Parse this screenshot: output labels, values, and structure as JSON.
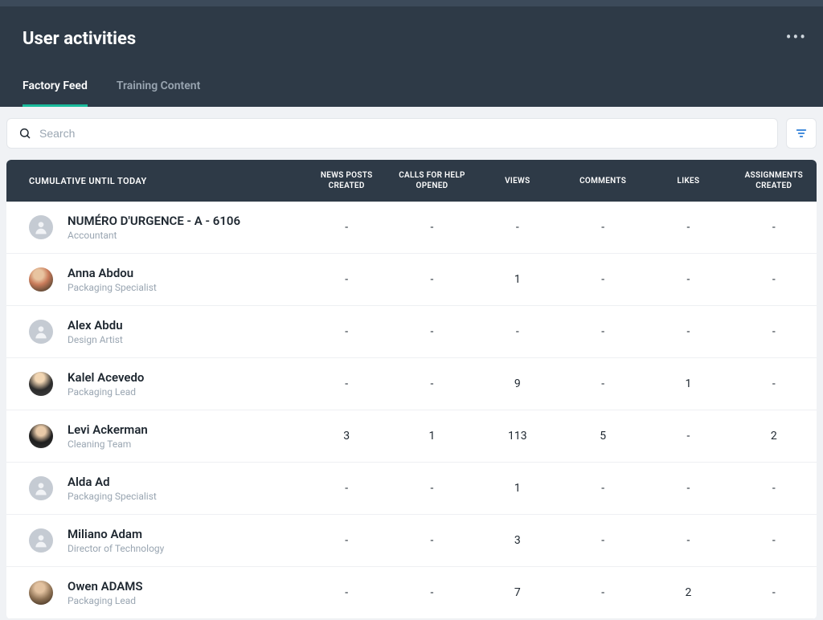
{
  "header": {
    "title": "User activities"
  },
  "tabs": {
    "items": [
      {
        "label": "Factory Feed",
        "active": true
      },
      {
        "label": "Training Content",
        "active": false
      }
    ]
  },
  "search": {
    "placeholder": "Search"
  },
  "table": {
    "userHeader": "CUMULATIVE UNTIL TODAY",
    "columns": [
      "NEWS POSTS CREATED",
      "CALLS FOR HELP OPENED",
      "VIEWS",
      "COMMENTS",
      "LIKES",
      "ASSIGNMENTS CREATED"
    ],
    "rows": [
      {
        "name": "NUMÉRO D'URGENCE - A - 6106",
        "role": "Accountant",
        "avatar": "placeholder",
        "vals": [
          "-",
          "-",
          "-",
          "-",
          "-",
          "-"
        ]
      },
      {
        "name": "Anna Abdou",
        "role": "Packaging Specialist",
        "avatar": "photo-1",
        "vals": [
          "-",
          "-",
          "1",
          "-",
          "-",
          "-"
        ]
      },
      {
        "name": "Alex Abdu",
        "role": "Design Artist",
        "avatar": "placeholder",
        "vals": [
          "-",
          "-",
          "-",
          "-",
          "-",
          "-"
        ]
      },
      {
        "name": "Kalel Acevedo",
        "role": "Packaging Lead",
        "avatar": "photo-2",
        "vals": [
          "-",
          "-",
          "9",
          "-",
          "1",
          "-"
        ]
      },
      {
        "name": "Levi Ackerman",
        "role": "Cleaning Team",
        "avatar": "photo-3",
        "vals": [
          "3",
          "1",
          "113",
          "5",
          "-",
          "2"
        ]
      },
      {
        "name": "Alda Ad",
        "role": "Packaging Specialist",
        "avatar": "placeholder",
        "vals": [
          "-",
          "-",
          "1",
          "-",
          "-",
          "-"
        ]
      },
      {
        "name": "Miliano Adam",
        "role": "Director of Technology",
        "avatar": "placeholder",
        "vals": [
          "-",
          "-",
          "3",
          "-",
          "-",
          "-"
        ]
      },
      {
        "name": "Owen ADAMS",
        "role": "Packaging Lead",
        "avatar": "photo-4",
        "vals": [
          "-",
          "-",
          "7",
          "-",
          "2",
          "-"
        ]
      }
    ]
  }
}
